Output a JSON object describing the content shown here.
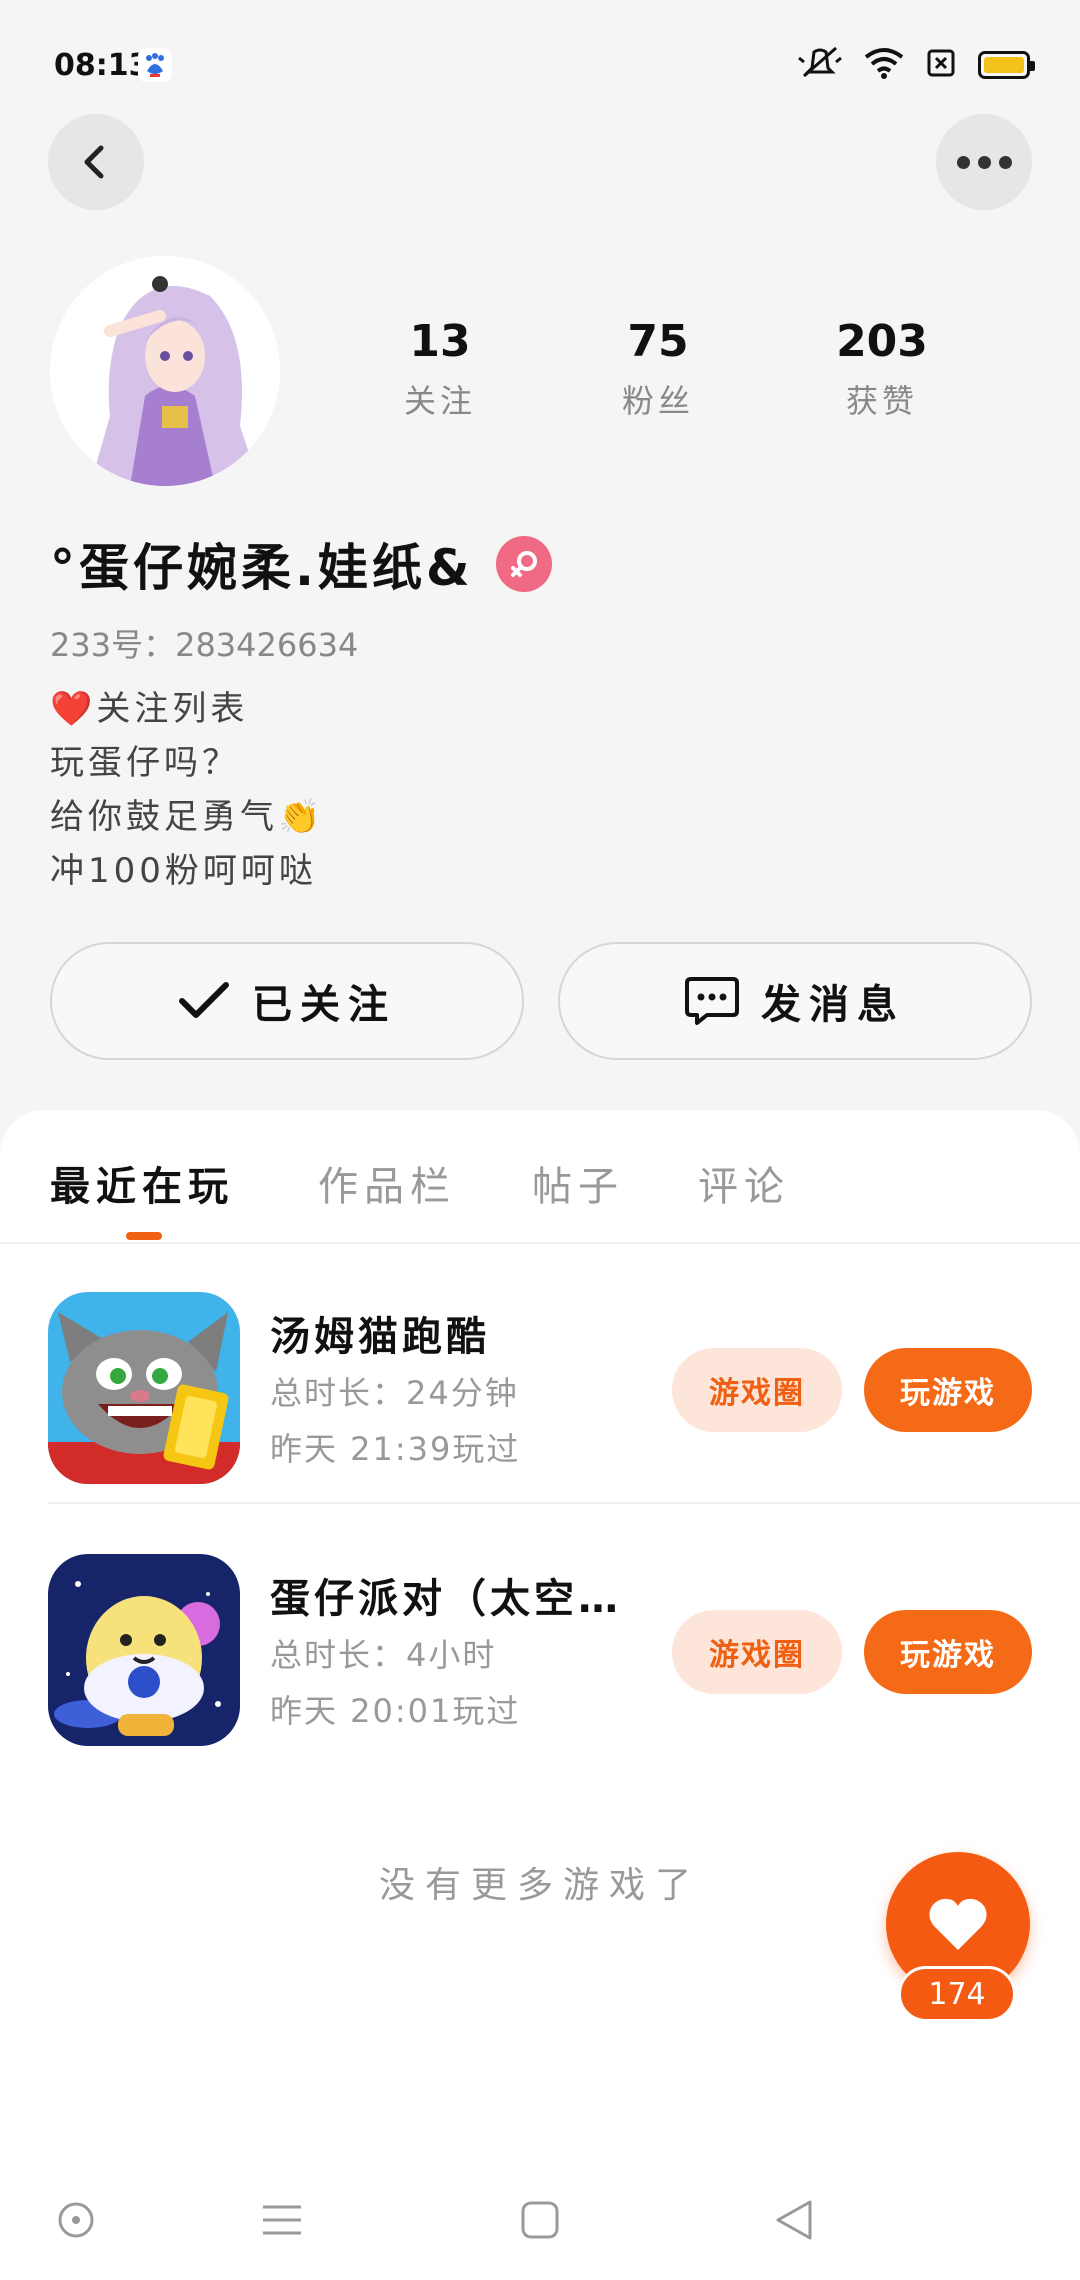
{
  "status_bar": {
    "time": "08:13",
    "icons": [
      "baidu-app-icon",
      "mute-icon",
      "wifi-icon",
      "sim-icon",
      "battery-icon"
    ]
  },
  "header": {
    "back_icon": "chevron-left-icon",
    "more_icon": "more-dots-icon"
  },
  "profile": {
    "avatar": "anime-girl-avatar",
    "stats": [
      {
        "value": "13",
        "label": "关注"
      },
      {
        "value": "75",
        "label": "粉丝"
      },
      {
        "value": "203",
        "label": "获赞"
      }
    ],
    "username": "°蛋仔婉柔.娃纸&",
    "gender_icon": "female-icon",
    "user_id": "233号：283426634",
    "bio": {
      "line1_emoji": "❤️",
      "line1": "关注列表",
      "line2": "玩蛋仔吗？",
      "line3": "给你鼓足勇气",
      "line3_emoji": "👏",
      "line4": "冲100粉呵呵哒"
    },
    "follow_button": "已关注",
    "message_button": "发消息"
  },
  "tabs": [
    {
      "label": "最近在玩",
      "active": true
    },
    {
      "label": "作品栏",
      "active": false
    },
    {
      "label": "帖子",
      "active": false
    },
    {
      "label": "评论",
      "active": false
    }
  ],
  "games": [
    {
      "name": "汤姆猫跑酷",
      "duration": "总时长：24分钟",
      "last_played": "昨天 21:39玩过",
      "circle_button": "游戏圈",
      "play_button": "玩游戏"
    },
    {
      "name": "蛋仔派对（太空…",
      "duration": "总时长：4小时",
      "last_played": "昨天 20:01玩过",
      "circle_button": "游戏圈",
      "play_button": "玩游戏"
    }
  ],
  "no_more_text": "没有更多游戏了",
  "like": {
    "count": "174",
    "icon": "heart-icon"
  },
  "colors": {
    "accent": "#f56a16",
    "accent_light": "#fde6d9",
    "gender_female": "#f06a86",
    "battery": "#f2c21b"
  },
  "nav_bar": [
    "screenshot-icon",
    "menu-icon",
    "home-square-icon",
    "back-triangle-icon"
  ]
}
